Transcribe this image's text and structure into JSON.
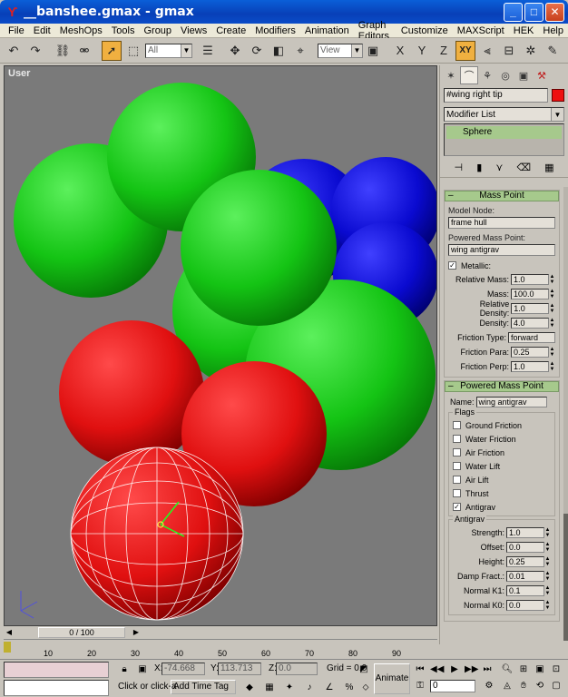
{
  "window": {
    "title": "__banshee.gmax - gmax",
    "app_icon": "gmax-icon",
    "minimize": "_",
    "maximize": "□",
    "close": "✕"
  },
  "menu": [
    "File",
    "Edit",
    "MeshOps",
    "Tools",
    "Group",
    "Views",
    "Create",
    "Modifiers",
    "Animation",
    "Graph Editors",
    "Customize",
    "MAXScript",
    "HEK",
    "Help"
  ],
  "toolbar": {
    "selection_filter": "All",
    "ref_coord": "View",
    "axis_buttons": [
      "X",
      "Y",
      "Z",
      "XY"
    ]
  },
  "viewport": {
    "label": "User"
  },
  "command_panel": {
    "object_name": "#wing right tip",
    "object_color": "#ee1010",
    "modifier_list": "Modifier List",
    "stack_item": "Sphere",
    "mass_point": {
      "header": "Mass Point",
      "model_node_label": "Model Node:",
      "model_node_value": "frame hull",
      "powered_label": "Powered Mass Point:",
      "powered_value": "wing antigrav",
      "metallic_label": "Metallic:",
      "metallic_checked": true,
      "spinners": [
        {
          "label": "Relative Mass:",
          "value": "1.0"
        },
        {
          "label": "Mass:",
          "value": "100.0"
        },
        {
          "label": "Relative Density:",
          "value": "1.0"
        },
        {
          "label": "Density:",
          "value": "4.0"
        }
      ],
      "friction_type_label": "Friction Type:",
      "friction_type_value": "forward",
      "friction_spinners": [
        {
          "label": "Friction Para:",
          "value": "0.25"
        },
        {
          "label": "Friction Perp:",
          "value": "1.0"
        }
      ]
    },
    "powered_mass_point": {
      "header": "Powered Mass Point",
      "name_label": "Name:",
      "name_value": "wing antigrav",
      "flags_title": "Flags",
      "flags": [
        {
          "label": "Ground Friction",
          "checked": false
        },
        {
          "label": "Water Friction",
          "checked": false
        },
        {
          "label": "Air Friction",
          "checked": false
        },
        {
          "label": "Water Lift",
          "checked": false
        },
        {
          "label": "Air Lift",
          "checked": false
        },
        {
          "label": "Thrust",
          "checked": false
        },
        {
          "label": "Antigrav",
          "checked": true
        }
      ],
      "antigrav_title": "Antigrav",
      "antigrav_spinners": [
        {
          "label": "Strength:",
          "value": "1.0"
        },
        {
          "label": "Offset:",
          "value": "0.0"
        },
        {
          "label": "Height:",
          "value": "0.25"
        },
        {
          "label": "Damp Fract.:",
          "value": "0.01"
        },
        {
          "label": "Normal K1:",
          "value": "0.1"
        },
        {
          "label": "Normal K0:",
          "value": "0.0"
        }
      ]
    }
  },
  "timeline": {
    "frame": "0 / 100",
    "ticks": [
      "10",
      "20",
      "30",
      "40",
      "50",
      "60",
      "70",
      "80",
      "90"
    ]
  },
  "status": {
    "x_label": "X:",
    "x_value": "-74.668",
    "y_label": "Y:",
    "y_value": "113.713",
    "z_label": "Z:",
    "z_value": "0.0",
    "grid": "Grid = 0.0",
    "prompt": "Click or click-a",
    "add_time_tag": "Add Time Tag",
    "animate": "Animate",
    "current_frame": "0"
  }
}
